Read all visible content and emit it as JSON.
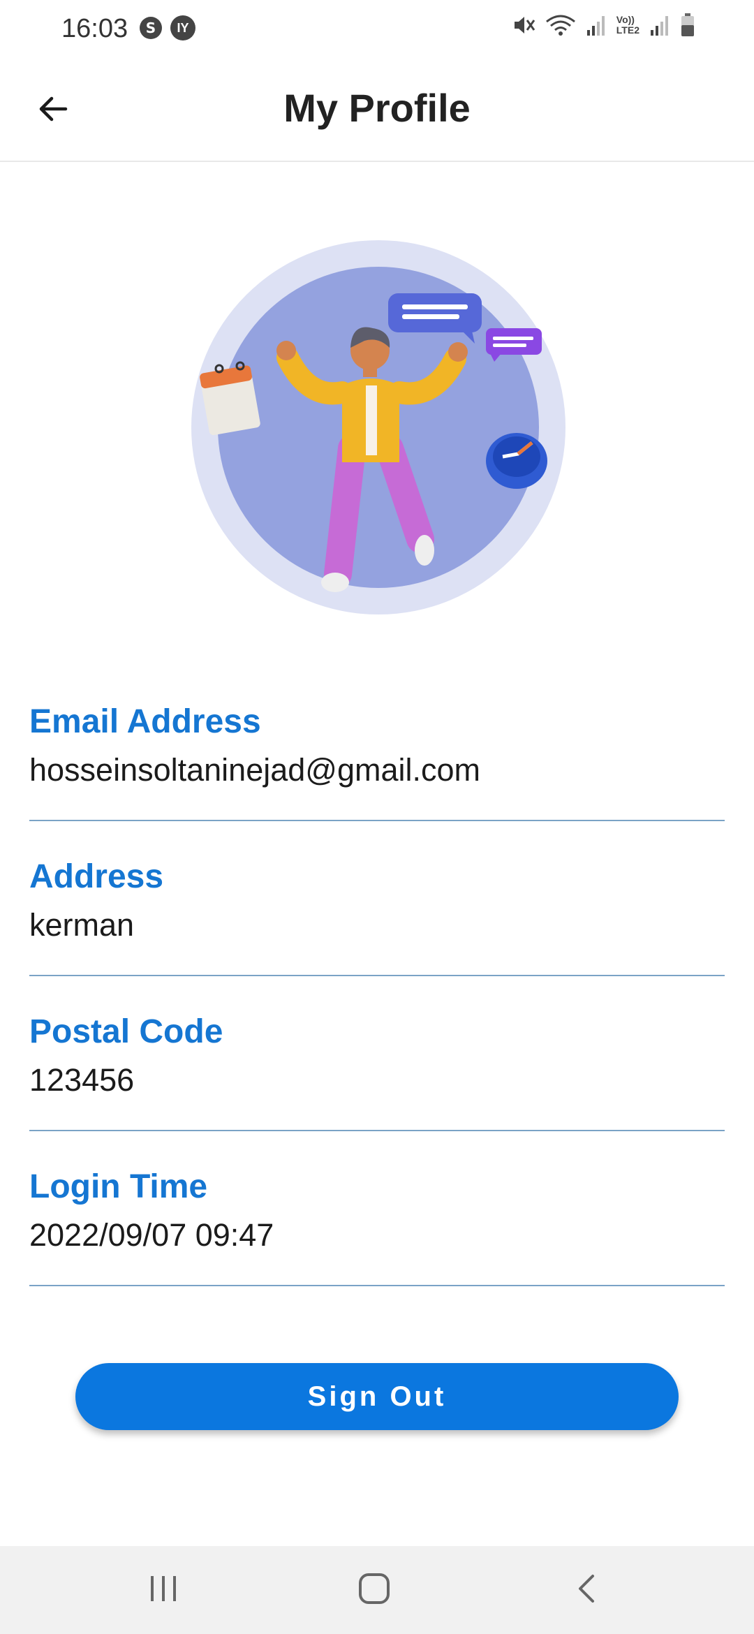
{
  "status_bar": {
    "time": "16:03",
    "left_icons": [
      "sync-icon",
      "IY"
    ],
    "right_icons": [
      "mute-icon",
      "wifi-icon",
      "signal-icon",
      "volte-icon",
      "signal-icon-2",
      "battery-icon"
    ],
    "volte_label": "Vo))",
    "lte_label": "LTE2"
  },
  "app_bar": {
    "back_icon": "arrow-left-icon",
    "title": "My Profile"
  },
  "profile": {
    "illustration": "person-jumping-illustration",
    "fields": [
      {
        "label": "Email Address",
        "value": "hosseinsoltaninejad@gmail.com"
      },
      {
        "label": "Address",
        "value": "kerman"
      },
      {
        "label": "Postal Code",
        "value": "123456"
      },
      {
        "label": "Login Time",
        "value": "2022/09/07 09:47"
      }
    ]
  },
  "actions": {
    "sign_out_label": "Sign Out"
  },
  "colors": {
    "accent": "#0b77df",
    "label_blue": "#1576d2",
    "divider": "#7aa3c6",
    "nav_bg": "#f1f1f1"
  },
  "nav_bar": {
    "items": [
      "recents-icon",
      "home-icon",
      "back-icon"
    ]
  }
}
